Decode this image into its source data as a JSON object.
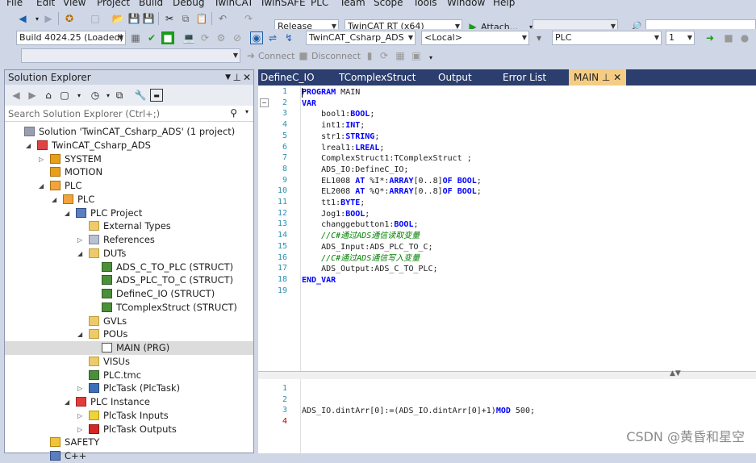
{
  "menu": [
    "File",
    "Edit",
    "View",
    "Project",
    "Build",
    "Debug",
    "TwinCAT",
    "TwinSAFE",
    "PLC",
    "Team",
    "Scope",
    "Tools",
    "Window",
    "Help"
  ],
  "toolbar1": {
    "config": "Release",
    "platform": "TwinCAT RT (x64)",
    "attach": "Attach..."
  },
  "toolbar2": {
    "build": "Build 4024.25 (Loaded)",
    "project": "TwinCAT_Csharp_ADS",
    "target": "<Local>",
    "plc": "PLC",
    "count": "1"
  },
  "toolbar3": {
    "connect": "Connect",
    "disconnect": "Disconnect"
  },
  "solution_explorer": {
    "title": "Solution Explorer",
    "search_placeholder": "Search Solution Explorer (Ctrl+;)",
    "tree": [
      {
        "label": "Solution 'TwinCAT_Csharp_ADS' (1 project)",
        "depth": 0,
        "icon": "solution-icon",
        "expander": ""
      },
      {
        "label": "TwinCAT_Csharp_ADS",
        "depth": 1,
        "icon": "twincat-project-icon",
        "expander": "open"
      },
      {
        "label": "SYSTEM",
        "depth": 2,
        "icon": "system-icon",
        "expander": "closed"
      },
      {
        "label": "MOTION",
        "depth": 2,
        "icon": "motion-icon",
        "expander": ""
      },
      {
        "label": "PLC",
        "depth": 2,
        "icon": "plc-icon",
        "expander": "open"
      },
      {
        "label": "PLC",
        "depth": 3,
        "icon": "plc-project-icon",
        "expander": "open"
      },
      {
        "label": "PLC Project",
        "depth": 4,
        "icon": "plc-project-node-icon",
        "expander": "open"
      },
      {
        "label": "External Types",
        "depth": 5,
        "icon": "folder-icon",
        "expander": ""
      },
      {
        "label": "References",
        "depth": 5,
        "icon": "references-icon",
        "expander": "closed"
      },
      {
        "label": "DUTs",
        "depth": 5,
        "icon": "folder-open-icon",
        "expander": "open"
      },
      {
        "label": "ADS_C_TO_PLC (STRUCT)",
        "depth": 6,
        "icon": "struct-icon",
        "expander": ""
      },
      {
        "label": "ADS_PLC_TO_C (STRUCT)",
        "depth": 6,
        "icon": "struct-icon",
        "expander": ""
      },
      {
        "label": "DefineC_IO (STRUCT)",
        "depth": 6,
        "icon": "struct-icon",
        "expander": ""
      },
      {
        "label": "TComplexStruct (STRUCT)",
        "depth": 6,
        "icon": "struct-icon",
        "expander": ""
      },
      {
        "label": "GVLs",
        "depth": 5,
        "icon": "folder-icon",
        "expander": ""
      },
      {
        "label": "POUs",
        "depth": 5,
        "icon": "folder-open-icon",
        "expander": "open"
      },
      {
        "label": "MAIN (PRG)",
        "depth": 6,
        "icon": "program-icon",
        "expander": "",
        "selected": true
      },
      {
        "label": "VISUs",
        "depth": 5,
        "icon": "folder-icon",
        "expander": ""
      },
      {
        "label": "PLC.tmc",
        "depth": 5,
        "icon": "tmc-file-icon",
        "expander": ""
      },
      {
        "label": "PlcTask (PlcTask)",
        "depth": 5,
        "icon": "task-icon",
        "expander": "closed"
      },
      {
        "label": "PLC Instance",
        "depth": 4,
        "icon": "plc-instance-icon",
        "expander": "open"
      },
      {
        "label": "PlcTask Inputs",
        "depth": 5,
        "icon": "inputs-icon",
        "expander": "closed"
      },
      {
        "label": "PlcTask Outputs",
        "depth": 5,
        "icon": "outputs-icon",
        "expander": "closed"
      },
      {
        "label": "SAFETY",
        "depth": 2,
        "icon": "safety-icon",
        "expander": ""
      },
      {
        "label": "C++",
        "depth": 2,
        "icon": "cpp-icon",
        "expander": ""
      }
    ]
  },
  "editor": {
    "tabs": [
      "DefineC_IO",
      "TComplexStruct",
      "Output",
      "Error List",
      "MAIN"
    ],
    "active_tab": "MAIN",
    "declaration": [
      {
        "n": "1",
        "t": [
          [
            "kw",
            "PROGRAM"
          ],
          [
            "id",
            " MAIN"
          ]
        ]
      },
      {
        "n": "2",
        "t": [
          [
            "kw",
            "VAR"
          ]
        ]
      },
      {
        "n": "3",
        "t": [
          [
            "id",
            "    bool1:"
          ],
          [
            "kw",
            "BOOL"
          ],
          [
            "id",
            ";"
          ]
        ]
      },
      {
        "n": "4",
        "t": [
          [
            "id",
            "    int1:"
          ],
          [
            "kw",
            "INT"
          ],
          [
            "id",
            ";"
          ]
        ]
      },
      {
        "n": "5",
        "t": [
          [
            "id",
            "    str1:"
          ],
          [
            "kw",
            "STRING"
          ],
          [
            "id",
            ";"
          ]
        ]
      },
      {
        "n": "6",
        "t": [
          [
            "id",
            "    lreal1:"
          ],
          [
            "kw",
            "LREAL"
          ],
          [
            "id",
            ";"
          ]
        ]
      },
      {
        "n": "7",
        "t": [
          [
            "id",
            "    ComplexStruct1:TComplexStruct ;"
          ]
        ]
      },
      {
        "n": "8",
        "t": [
          [
            "id",
            "    ADS_IO:DefineC_IO;"
          ]
        ]
      },
      {
        "n": "9",
        "t": [
          [
            "id",
            "    EL1008 "
          ],
          [
            "kw",
            "AT"
          ],
          [
            "id",
            " %I*:"
          ],
          [
            "kw",
            "ARRAY"
          ],
          [
            "id",
            "[0..8]"
          ],
          [
            "kw",
            "OF"
          ],
          [
            "id",
            " "
          ],
          [
            "kw",
            "BOOL"
          ],
          [
            "id",
            ";"
          ]
        ]
      },
      {
        "n": "10",
        "t": [
          [
            "id",
            "    EL2008 "
          ],
          [
            "kw",
            "AT"
          ],
          [
            "id",
            " %Q*:"
          ],
          [
            "kw",
            "ARRAY"
          ],
          [
            "id",
            "[0..8]"
          ],
          [
            "kw",
            "OF"
          ],
          [
            "id",
            " "
          ],
          [
            "kw",
            "BOOL"
          ],
          [
            "id",
            ";"
          ]
        ]
      },
      {
        "n": "11",
        "t": [
          [
            "id",
            "    tt1:"
          ],
          [
            "kw",
            "BYTE"
          ],
          [
            "id",
            ";"
          ]
        ]
      },
      {
        "n": "12",
        "t": [
          [
            "id",
            "    Jog1:"
          ],
          [
            "kw",
            "BOOL"
          ],
          [
            "id",
            ";"
          ]
        ]
      },
      {
        "n": "13",
        "t": [
          [
            "id",
            "    changgebutton1:"
          ],
          [
            "kw",
            "BOOL"
          ],
          [
            "id",
            ";"
          ]
        ]
      },
      {
        "n": "14",
        "t": [
          [
            "cm",
            "    //C#通过ADS通信读取变量"
          ]
        ]
      },
      {
        "n": "15",
        "t": [
          [
            "id",
            "    ADS_Input:ADS_PLC_TO_C;"
          ]
        ]
      },
      {
        "n": "16",
        "t": [
          [
            "cm",
            "    //C#通过ADS通信写入变量"
          ]
        ]
      },
      {
        "n": "17",
        "t": [
          [
            "id",
            "    ADS_Output:ADS_C_TO_PLC;"
          ]
        ]
      },
      {
        "n": "18",
        "t": [
          [
            "kw",
            "END_VAR"
          ]
        ]
      },
      {
        "n": "19",
        "t": []
      }
    ],
    "implementation": [
      {
        "n": "1",
        "t": []
      },
      {
        "n": "2",
        "t": []
      },
      {
        "n": "3",
        "t": [
          [
            "id",
            "ADS_IO.dintArr[0]:=(ADS_IO.dintArr[0]+1)"
          ],
          [
            "kw",
            "MOD"
          ],
          [
            "id",
            " 500;"
          ]
        ]
      },
      {
        "n": "4",
        "t": []
      }
    ]
  },
  "watermark": "CSDN @黄昏和星空"
}
